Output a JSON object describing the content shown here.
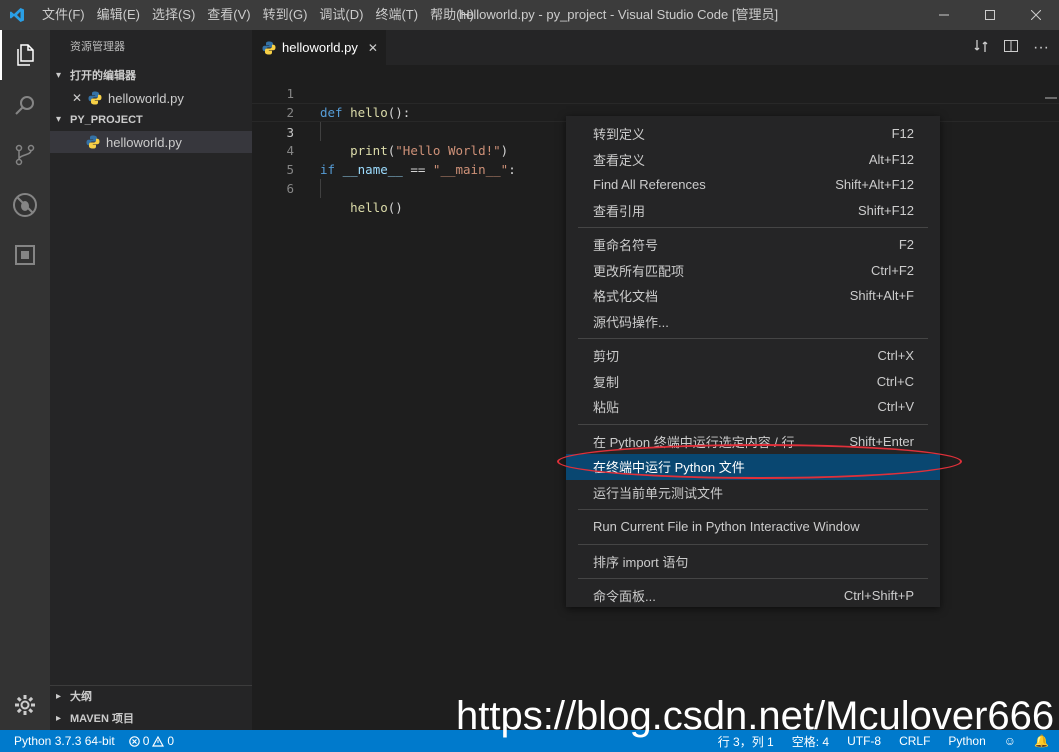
{
  "titlebar": {
    "menu": [
      "文件(F)",
      "编辑(E)",
      "选择(S)",
      "查看(V)",
      "转到(G)",
      "调试(D)",
      "终端(T)",
      "帮助(H)"
    ],
    "title": "helloworld.py - py_project - Visual Studio Code [管理员]"
  },
  "sidebar": {
    "title": "资源管理器",
    "open_editors_label": "打开的编辑器",
    "open_editor_file": "helloworld.py",
    "project_label": "PY_PROJECT",
    "project_file": "helloworld.py",
    "outline_label": "大纲",
    "maven_label": "MAVEN 项目"
  },
  "editor": {
    "tab_label": "helloworld.py",
    "lines": [
      {
        "n": "1"
      },
      {
        "n": "2"
      },
      {
        "n": "3"
      },
      {
        "n": "4"
      },
      {
        "n": "5"
      },
      {
        "n": "6"
      }
    ]
  },
  "context_menu": {
    "items": [
      {
        "label": "转到定义",
        "key": "F12"
      },
      {
        "label": "查看定义",
        "key": "Alt+F12"
      },
      {
        "label": "Find All References",
        "key": "Shift+Alt+F12"
      },
      {
        "label": "查看引用",
        "key": "Shift+F12"
      },
      {
        "label": "重命名符号",
        "key": "F2"
      },
      {
        "label": "更改所有匹配项",
        "key": "Ctrl+F2"
      },
      {
        "label": "格式化文档",
        "key": "Shift+Alt+F"
      },
      {
        "label": "源代码操作...",
        "key": ""
      },
      {
        "label": "剪切",
        "key": "Ctrl+X"
      },
      {
        "label": "复制",
        "key": "Ctrl+C"
      },
      {
        "label": "粘贴",
        "key": "Ctrl+V"
      },
      {
        "label": "在 Python 终端中运行选定内容 / 行",
        "key": "Shift+Enter"
      },
      {
        "label": "在终端中运行 Python 文件",
        "key": ""
      },
      {
        "label": "运行当前单元测试文件",
        "key": ""
      },
      {
        "label": "Run Current File in Python Interactive Window",
        "key": ""
      },
      {
        "label": "排序 import 语句",
        "key": ""
      },
      {
        "label": "命令面板...",
        "key": "Ctrl+Shift+P"
      }
    ]
  },
  "statusbar": {
    "python_version": "Python 3.7.3 64-bit",
    "errors": "0",
    "warnings": "0",
    "position": "行 3，列 1",
    "spaces": "空格: 4",
    "encoding": "UTF-8",
    "eol": "CRLF",
    "language": "Python"
  },
  "watermark": "https://blog.csdn.net/Mculover666",
  "colors": {
    "statusbar": "#007acc",
    "menu_active": "#094771",
    "highlight": "#e0303a"
  }
}
